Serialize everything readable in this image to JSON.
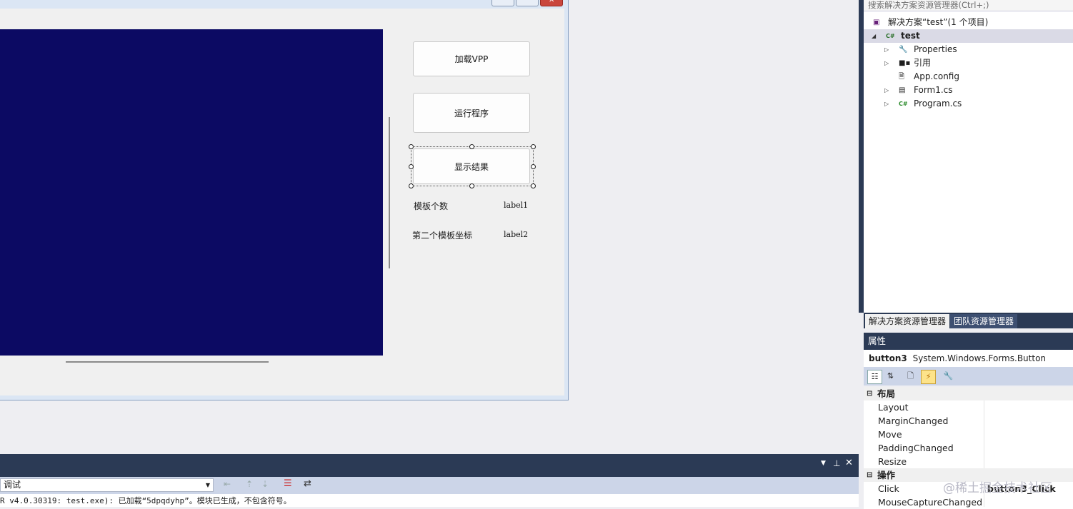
{
  "designer": {
    "form_buttons": {
      "load_vpp": "加载VPP",
      "run_program": "运行程序",
      "show_result": "显示结果"
    },
    "labels": [
      {
        "caption": "模板个数",
        "value": "label1"
      },
      {
        "caption": "第二个模板坐标",
        "value": "label2"
      }
    ],
    "picture_color": "#0c0a63"
  },
  "solution_explorer": {
    "search_placeholder": "搜索解决方案资源管理器(Ctrl+;)",
    "items": [
      {
        "label": "解决方案“test”(1 个项目)",
        "icon": "solution-icon"
      },
      {
        "label": "test",
        "icon": "csharp-project-icon"
      },
      {
        "label": "Properties",
        "icon": "wrench-icon"
      },
      {
        "label": "引用",
        "icon": "references-icon"
      },
      {
        "label": "App.config",
        "icon": "config-icon"
      },
      {
        "label": "Form1.cs",
        "icon": "form-icon"
      },
      {
        "label": "Program.cs",
        "icon": "csharp-file-icon"
      }
    ],
    "tabs": [
      "解决方案资源管理器",
      "团队资源管理器"
    ]
  },
  "properties": {
    "title": "属性",
    "object_name": "button3",
    "object_type": "System.Windows.Forms.Button",
    "categories": [
      {
        "name": "布局",
        "items": [
          {
            "name": "Layout",
            "value": ""
          },
          {
            "name": "MarginChanged",
            "value": ""
          },
          {
            "name": "Move",
            "value": ""
          },
          {
            "name": "PaddingChanged",
            "value": ""
          },
          {
            "name": "Resize",
            "value": ""
          }
        ]
      },
      {
        "name": "操作",
        "items": [
          {
            "name": "Click",
            "value": "button3_Click"
          },
          {
            "name": "MouseCaptureChanged",
            "value": ""
          }
        ]
      }
    ]
  },
  "output": {
    "source_selected": "调试",
    "text": "R v4.0.30319: test.exe): 已加载“5dpqdyhp”。模块已生成，不包含符号。"
  },
  "watermark": "@稀土掘金技术社区",
  "colors": {
    "accent": "#2b3a55",
    "panel_bg": "#eeeef2",
    "property_toolbar": "#ccd5e8"
  }
}
